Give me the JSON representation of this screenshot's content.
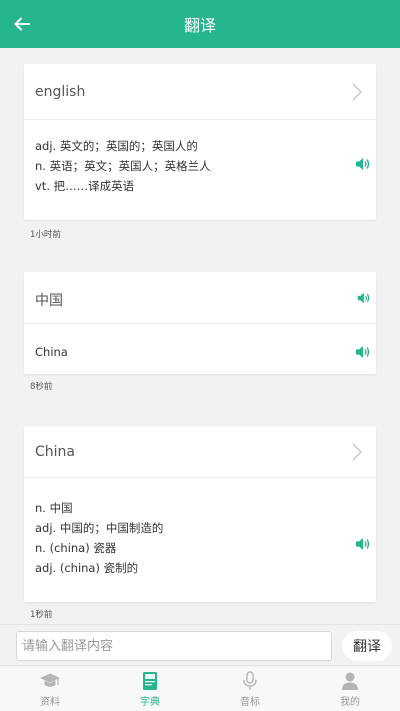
{
  "header": {
    "title": "翻译",
    "back_icon": "arrow-left-icon"
  },
  "history": [
    {
      "word": "english",
      "definitions": [
        "adj. 英文的；英国的；英国人的",
        "n. 英语；英文；英国人；英格兰人",
        "vt. 把……译成英语"
      ],
      "time": "1小时前"
    },
    {
      "word": "中国",
      "definitions": [
        "China"
      ],
      "time": "8秒前"
    },
    {
      "word": "China",
      "definitions": [
        "n. 中国",
        "adj. 中国的；中国制造的",
        "n. (china) 瓷器",
        "adj. (china) 瓷制的"
      ],
      "time": "1秒前"
    }
  ],
  "input": {
    "placeholder": "请输入翻译内容",
    "value": "",
    "button_label": "翻译"
  },
  "tabs": [
    {
      "label": "资料",
      "icon": "graduation-cap-icon",
      "active": false
    },
    {
      "label": "字典",
      "icon": "book-icon",
      "active": true
    },
    {
      "label": "音标",
      "icon": "microphone-icon",
      "active": false
    },
    {
      "label": "我的",
      "icon": "user-icon",
      "active": false
    }
  ],
  "colors": {
    "accent": "#25b58f",
    "inactive": "#999999"
  }
}
